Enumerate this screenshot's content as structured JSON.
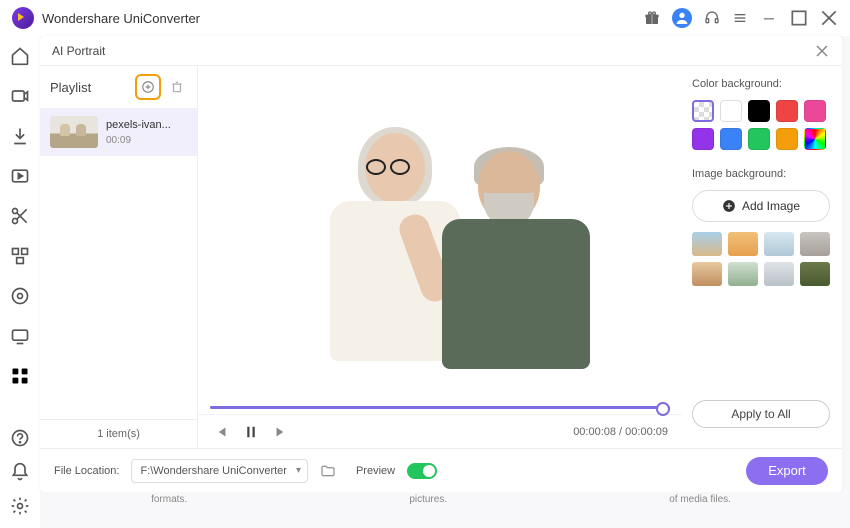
{
  "app": {
    "title": "Wondershare UniConverter"
  },
  "panel": {
    "title": "AI Portrait"
  },
  "playlist": {
    "label": "Playlist",
    "item": {
      "name": "pexels-ivan...",
      "duration": "00:09"
    },
    "footer": "1 item(s)"
  },
  "player": {
    "time_display": "00:00:08 / 00:00:09"
  },
  "right": {
    "color_label": "Color background:",
    "swatches": [
      "transparent",
      "#ffffff",
      "#000000",
      "#ef4444",
      "#ec4899",
      "#9333ea",
      "#3b82f6",
      "#22c55e",
      "#f59e0b",
      "rainbow"
    ],
    "image_label": "Image background:",
    "add_image_label": "Add Image",
    "bg_images": [
      "linear-gradient(180deg,#a8cfe8,#d8ba8a)",
      "linear-gradient(180deg,#f0c078,#e8a050)",
      "linear-gradient(180deg,#d8e8f0,#b0c8d8)",
      "linear-gradient(180deg,#c8c4c0,#a8a09a)",
      "linear-gradient(180deg,#e8c8a0,#c09060)",
      "linear-gradient(180deg,#d0e0d0,#90b090)",
      "linear-gradient(180deg,#e0e4e8,#b8c0c8)",
      "linear-gradient(180deg,#6a7a4a,#4a5a30)"
    ],
    "apply_all_label": "Apply to All"
  },
  "bottom": {
    "file_location_label": "File Location:",
    "file_location_value": "F:\\Wondershare UniConverter",
    "preview_label": "Preview",
    "export_label": "Export"
  },
  "footer_scraps": [
    "formats.",
    "pictures.",
    "of media files."
  ]
}
